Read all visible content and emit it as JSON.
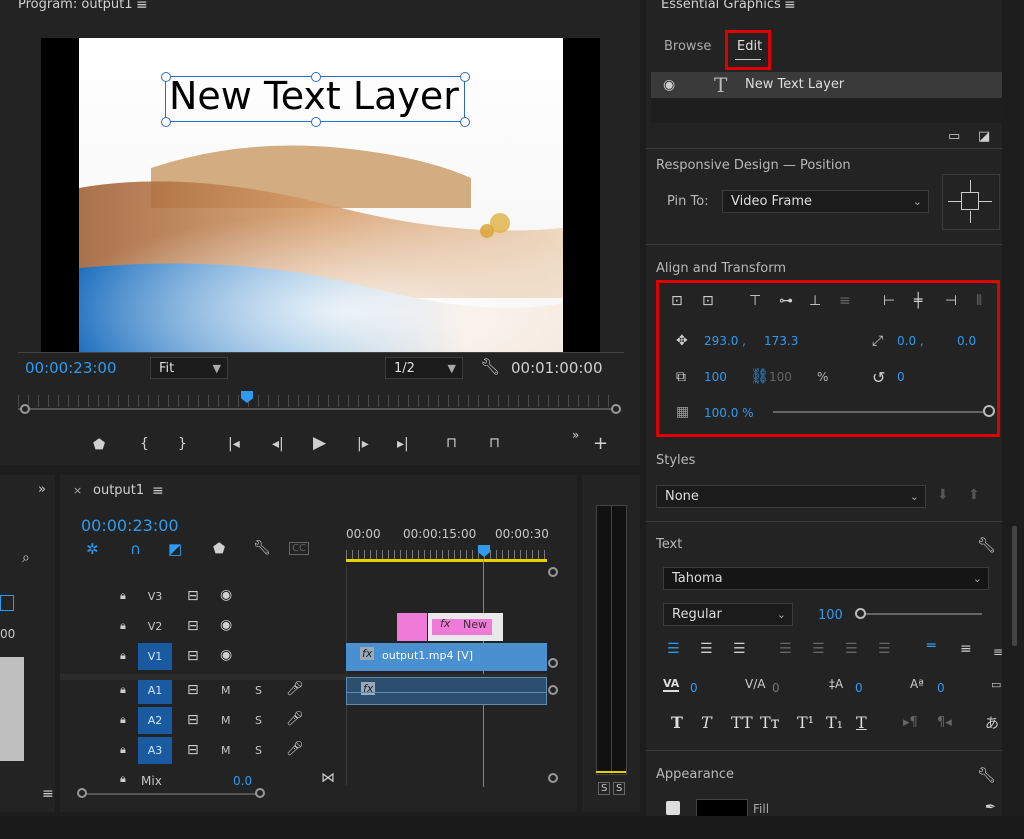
{
  "program": {
    "title": "Program: output1",
    "overlay_text": "New Text Layer",
    "timecode": "00:00:23:00",
    "fit": "Fit",
    "resolution": "1/2",
    "duration": "00:01:00:00"
  },
  "timeline": {
    "tab": "output1",
    "timecode": "00:00:23:00",
    "ruler": [
      "00:00",
      "00:00:15:00",
      "00:00:30"
    ],
    "tracks": [
      {
        "id": "V3",
        "m": "",
        "s": ""
      },
      {
        "id": "V2",
        "m": "",
        "s": ""
      },
      {
        "id": "V1",
        "m": "",
        "s": ""
      },
      {
        "id": "A1",
        "m": "M",
        "s": "S"
      },
      {
        "id": "A2",
        "m": "M",
        "s": "S"
      },
      {
        "id": "A3",
        "m": "M",
        "s": "S"
      }
    ],
    "mix_label": "Mix",
    "mix_value": "0.0",
    "clip_v2": "New",
    "clip_v1": "output1.mp4 [V]",
    "fx": "fx",
    "meter_solo": [
      "S",
      "S"
    ]
  },
  "left": {
    "value": "00"
  },
  "eg": {
    "title": "Essential Graphics",
    "tabs": [
      "Browse",
      "Edit"
    ],
    "layer": "New Text Layer",
    "responsive_label": "Responsive Design — Position",
    "pin_label": "Pin To:",
    "pin_value": "Video Frame",
    "align_label": "Align and Transform",
    "pos_x": "293.0 ,",
    "pos_y": "173.3",
    "anchor_x": "0.0 ,",
    "anchor_y": "0.0",
    "scale": "100",
    "scale2": "100",
    "percent": "%",
    "rotation": "0",
    "opacity": "100.0 %",
    "styles_label": "Styles",
    "styles_value": "None",
    "text_label": "Text",
    "font": "Tahoma",
    "font_style": "Regular",
    "font_size": "100",
    "kerning": "0",
    "tracking": "0",
    "leading": "0",
    "baseline": "0",
    "appearance_label": "Appearance",
    "fill_label": "Fill"
  },
  "colors": {
    "accent": "#2e9bf0",
    "highlight": "#e00000",
    "clip_pink": "#f07ad8",
    "clip_blue": "#4a8fd0"
  }
}
